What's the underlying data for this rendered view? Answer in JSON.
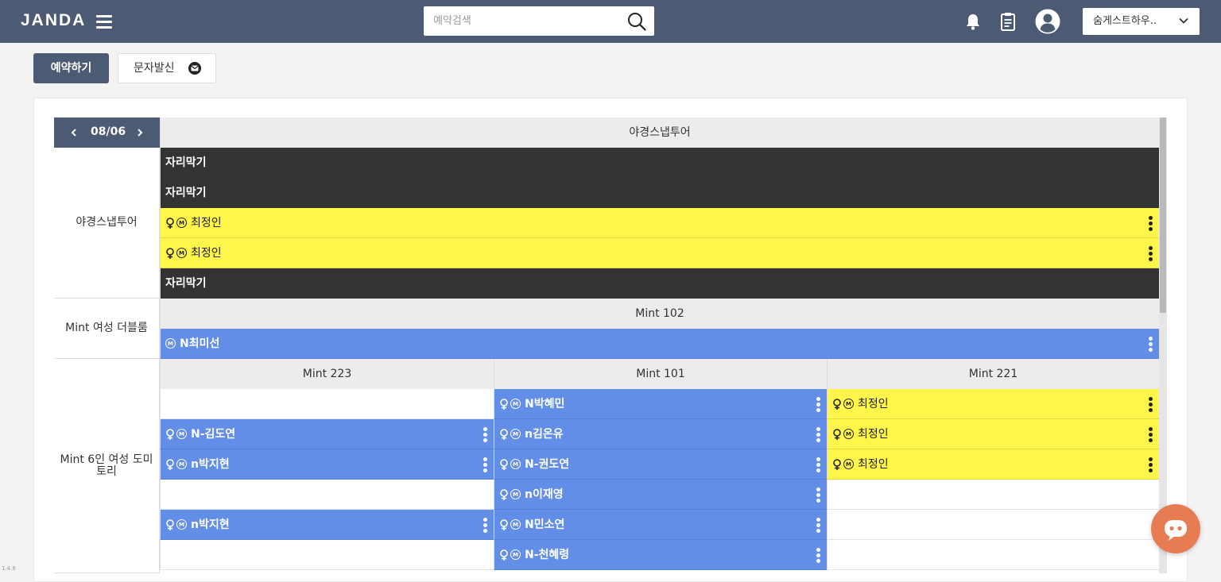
{
  "header": {
    "logo": "JANDA",
    "search_placeholder": "예약검색",
    "house_name": "숨게스트하우.."
  },
  "toolbar": {
    "reserve_label": "예약하기",
    "sms_label": "문자발신"
  },
  "calendar": {
    "date": "08/06"
  },
  "rooms": [
    {
      "name": "야경스냅투어",
      "beds": [
        {
          "name": "야경스냅투어",
          "slots": [
            {
              "type": "block",
              "label": "자리막기"
            },
            {
              "type": "block",
              "label": "자리막기"
            },
            {
              "type": "yellow",
              "female": true,
              "member": true,
              "name": "최정인"
            },
            {
              "type": "yellow",
              "female": true,
              "member": true,
              "name": "최정인"
            },
            {
              "type": "block",
              "label": "자리막기"
            }
          ]
        }
      ]
    },
    {
      "name": "Mint 여성 더블룸",
      "beds": [
        {
          "name": "Mint 102",
          "slots": [
            {
              "type": "blue",
              "female": false,
              "member": true,
              "name": "N최미선"
            }
          ]
        }
      ]
    },
    {
      "name": "Mint 6인 여성 도미토리",
      "beds": [
        {
          "name": "Mint 223",
          "slots": [
            {
              "type": "empty"
            },
            {
              "type": "blue",
              "female": true,
              "member": true,
              "name": "N-김도연"
            },
            {
              "type": "blue",
              "female": true,
              "member": true,
              "name": "n박지현"
            },
            {
              "type": "empty"
            },
            {
              "type": "blue",
              "female": true,
              "member": true,
              "name": "n박지현"
            },
            {
              "type": "empty"
            }
          ]
        },
        {
          "name": "Mint 101",
          "slots": [
            {
              "type": "blue",
              "female": true,
              "member": true,
              "name": "N박혜민"
            },
            {
              "type": "blue",
              "female": true,
              "member": true,
              "name": "n김온유"
            },
            {
              "type": "blue",
              "female": true,
              "member": true,
              "name": "N-권도연"
            },
            {
              "type": "blue",
              "female": true,
              "member": true,
              "name": "n이재영"
            },
            {
              "type": "blue",
              "female": true,
              "member": true,
              "name": "N민소연"
            },
            {
              "type": "blue",
              "female": true,
              "member": true,
              "name": "N-천혜령"
            }
          ]
        },
        {
          "name": "Mint 221",
          "slots": [
            {
              "type": "yellow",
              "female": true,
              "member": true,
              "name": "최정인"
            },
            {
              "type": "yellow",
              "female": true,
              "member": true,
              "name": "최정인"
            },
            {
              "type": "yellow",
              "female": true,
              "member": true,
              "name": "최정인"
            },
            {
              "type": "empty"
            },
            {
              "type": "empty"
            },
            {
              "type": "empty"
            }
          ]
        }
      ]
    }
  ],
  "colors": {
    "header_bg": "#4d5a73",
    "booking_yellow": "#fff54b",
    "booking_blue": "#628ee8",
    "blocked": "#333333",
    "chat_button": "#e77c53"
  },
  "icons": [
    "menu-icon",
    "search-icon",
    "bell-icon",
    "clipboard-icon",
    "user-icon",
    "chevron-down-icon",
    "mail-icon",
    "chevron-left-icon",
    "chevron-right-icon",
    "female-icon",
    "member-icon",
    "kebab-icon",
    "chat-icon"
  ],
  "footer": {
    "version": "1.4.8"
  }
}
